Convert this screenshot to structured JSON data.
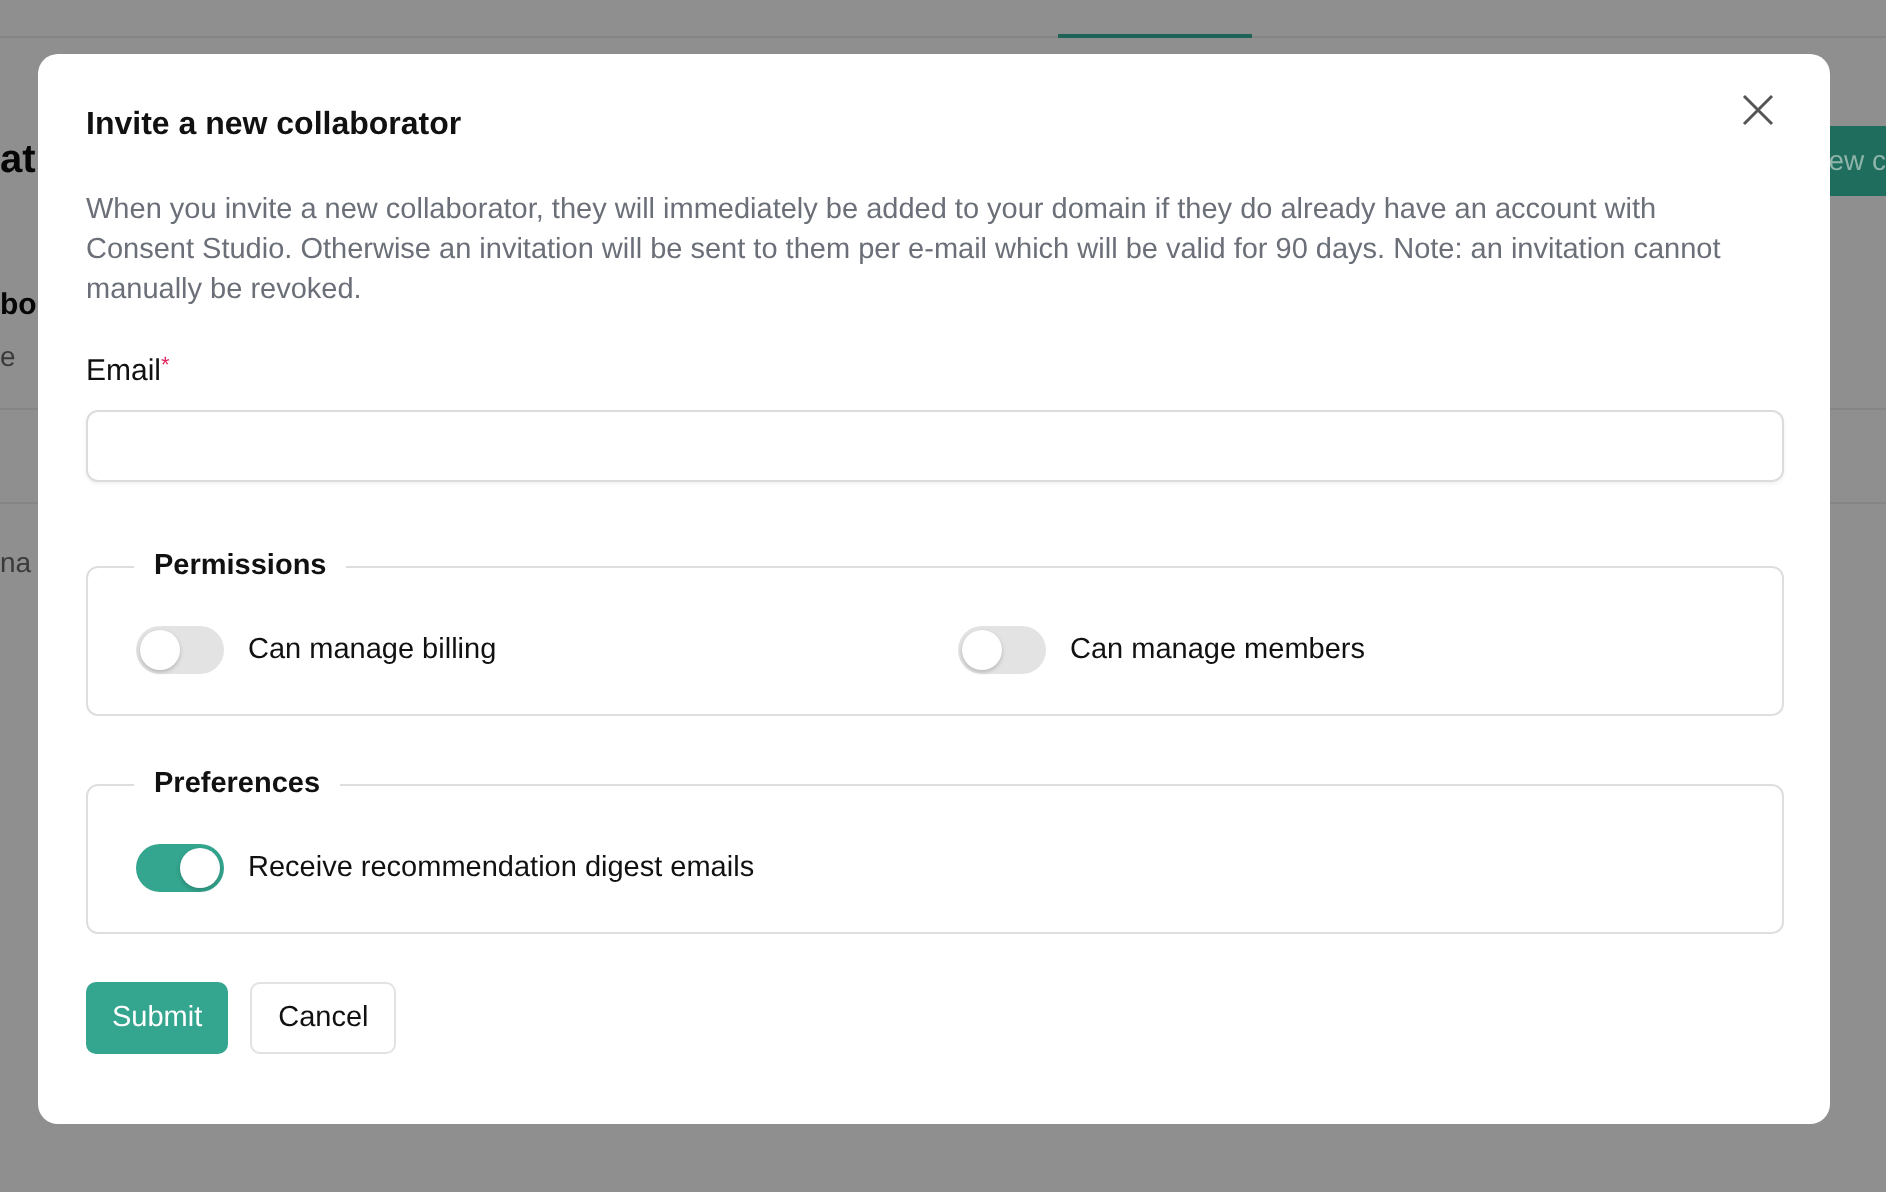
{
  "background": {
    "heading": "at",
    "button": "ew c",
    "subheading": "bo",
    "text": "e",
    "row_text": "na"
  },
  "dialog": {
    "title": "Invite a new collaborator",
    "description": "When you invite a new collaborator, they will immediately be added to your domain if they do already have an account with Consent Studio. Otherwise an invitation will be sent to them per e-mail which will be valid for 90 days. Note: an invitation cannot manually be revoked.",
    "email": {
      "label": "Email",
      "required_mark": "*"
    },
    "sections": [
      {
        "legend": "Permissions",
        "toggles": [
          {
            "label": "Can manage billing",
            "on": false
          },
          {
            "label": "Can manage members",
            "on": false
          }
        ]
      },
      {
        "legend": "Preferences",
        "toggles": [
          {
            "label": "Receive recommendation digest emails",
            "on": true
          }
        ]
      }
    ],
    "buttons": [
      {
        "label": "Submit",
        "kind": "primary"
      },
      {
        "label": "Cancel",
        "kind": "secondary"
      }
    ]
  }
}
